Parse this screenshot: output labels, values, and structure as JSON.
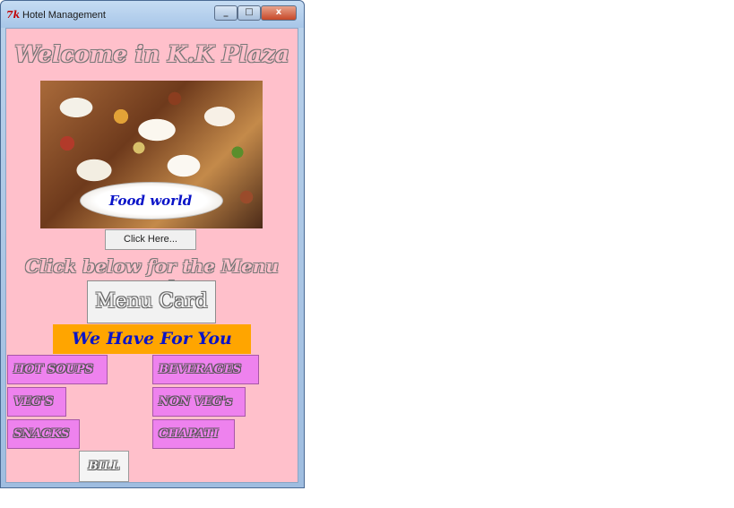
{
  "window": {
    "title": "Hotel Management",
    "app_icon_glyph": "7k",
    "controls": {
      "minimize": "_",
      "maximize": "□",
      "close": "x"
    }
  },
  "page": {
    "welcome_text": "Welcome in K.K Plaza",
    "image_label": "Food world",
    "click_here_label": "Click Here...",
    "menu_prompt": "Click below for the Menu card",
    "menu_card_label": "Menu Card",
    "offer_banner": "We Have For You",
    "categories_left": [
      "HOT SOUPS",
      "VEG'S",
      "SNACKS"
    ],
    "categories_right": [
      "BEVERAGES",
      "NON VEG's",
      "CHAPATI"
    ],
    "bill_label": "BILL"
  },
  "colors": {
    "background": "#ffc0cb",
    "banner": "#ffa500",
    "category_button": "#ee82ee",
    "accent_text": "#0a14c8"
  },
  "icons": {
    "app_icon": "app-logo-icon",
    "image": "food-photo"
  }
}
